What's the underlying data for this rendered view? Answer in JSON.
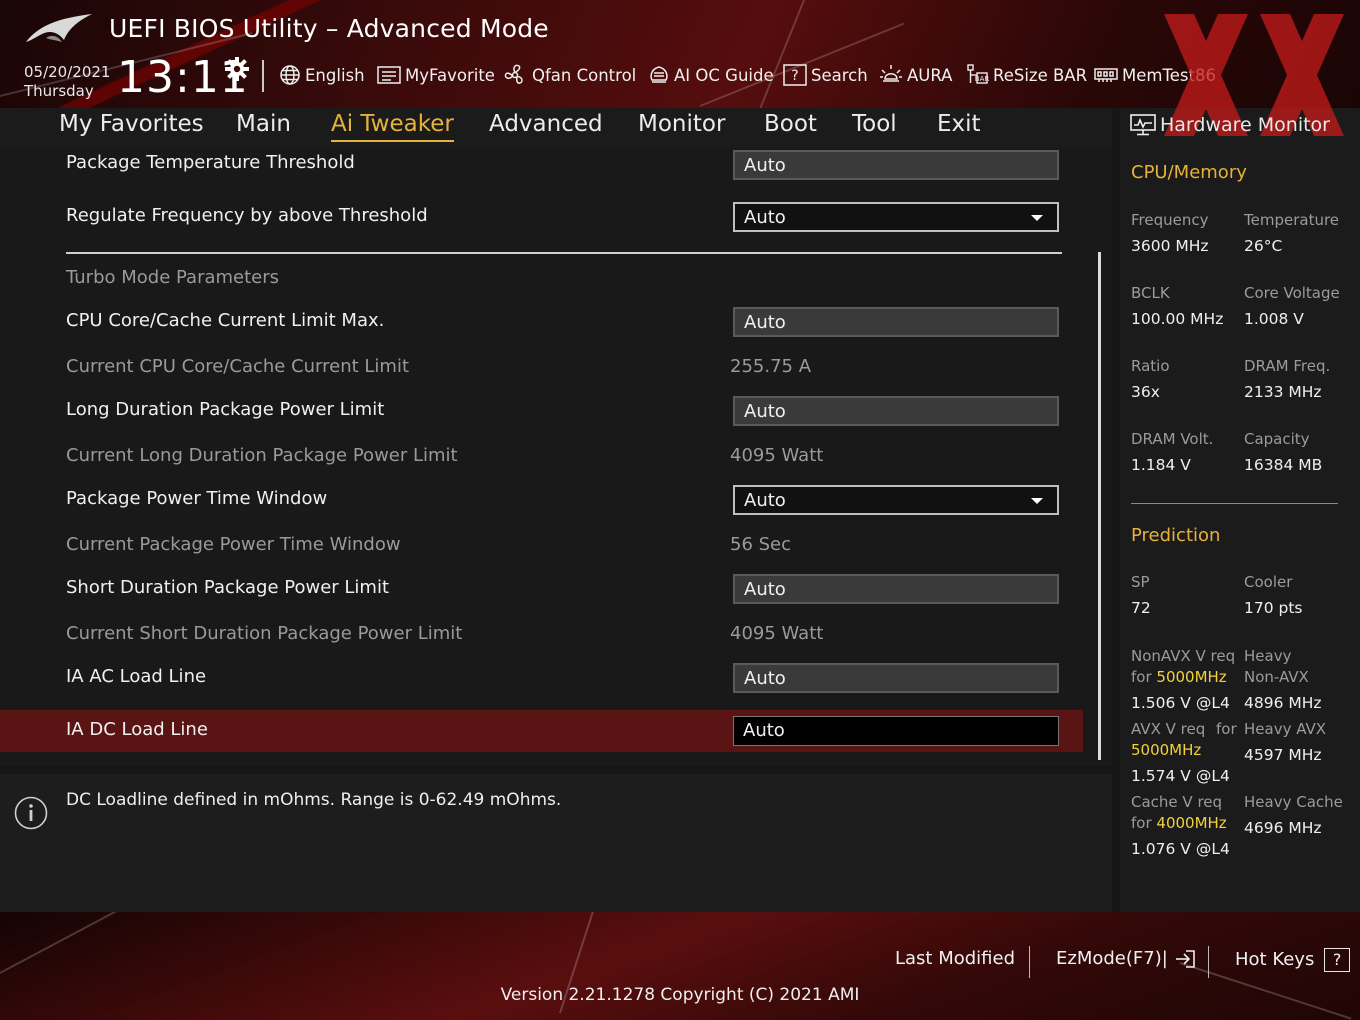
{
  "header": {
    "title": "UEFI BIOS Utility – Advanced Mode",
    "date": "05/20/2021",
    "day": "Thursday",
    "time": "13:11",
    "tools": [
      {
        "label": "English",
        "icon": "globe-icon"
      },
      {
        "label": "MyFavorite",
        "icon": "favorite-icon"
      },
      {
        "label": "Qfan Control",
        "icon": "fan-icon"
      },
      {
        "label": "AI OC Guide",
        "icon": "ai-chip-icon"
      },
      {
        "label": "Search",
        "icon": "help-box-icon"
      },
      {
        "label": "AURA",
        "icon": "aura-light-icon"
      },
      {
        "label": "ReSize BAR",
        "icon": "resize-bar-icon"
      },
      {
        "label": "MemTest86",
        "icon": "memtest-icon"
      }
    ]
  },
  "nav": {
    "tabs": [
      {
        "label": "My Favorites"
      },
      {
        "label": "Main"
      },
      {
        "label": "Ai Tweaker",
        "active": true
      },
      {
        "label": "Advanced"
      },
      {
        "label": "Monitor"
      },
      {
        "label": "Boot"
      },
      {
        "label": "Tool"
      },
      {
        "label": "Exit"
      }
    ]
  },
  "settings": {
    "package_temp_threshold": {
      "label": "Package Temperature Threshold",
      "value": "Auto"
    },
    "regulate_frequency": {
      "label": "Regulate Frequency by above Threshold",
      "value": "Auto"
    },
    "turbo_header": "Turbo Mode Parameters",
    "cpu_core_cache_limit": {
      "label": "CPU Core/Cache Current Limit Max.",
      "value": "Auto"
    },
    "current_cpu_core_cache_limit": {
      "label": "Current CPU Core/Cache Current Limit",
      "value": "255.75 A"
    },
    "long_duration_power_limit": {
      "label": "Long Duration Package Power Limit",
      "value": "Auto"
    },
    "current_long_duration_limit": {
      "label": "Current Long Duration Package Power Limit",
      "value": "4095 Watt"
    },
    "package_power_time_window": {
      "label": "Package Power Time Window",
      "value": "Auto"
    },
    "current_power_time_window": {
      "label": "Current Package Power Time Window",
      "value": "56 Sec"
    },
    "short_duration_power_limit": {
      "label": "Short Duration Package Power Limit",
      "value": "Auto"
    },
    "current_short_duration_limit": {
      "label": "Current Short Duration Package Power Limit",
      "value": "4095 Watt"
    },
    "ia_ac_load_line": {
      "label": "IA AC Load Line",
      "value": "Auto"
    },
    "ia_dc_load_line": {
      "label": "IA DC Load Line",
      "value": "Auto"
    }
  },
  "help": {
    "text": "DC Loadline defined in mOhms. Range is 0-62.49 mOhms."
  },
  "hardware_monitor": {
    "title": "Hardware Monitor",
    "cpu_memory": {
      "heading": "CPU/Memory",
      "frequency_label": "Frequency",
      "frequency": "3600 MHz",
      "temperature_label": "Temperature",
      "temperature": "26°C",
      "bclk_label": "BCLK",
      "bclk": "100.00 MHz",
      "core_voltage_label": "Core Voltage",
      "core_voltage": "1.008 V",
      "ratio_label": "Ratio",
      "ratio": "36x",
      "dram_freq_label": "DRAM Freq.",
      "dram_freq": "2133 MHz",
      "dram_volt_label": "DRAM Volt.",
      "dram_volt": "1.184 V",
      "capacity_label": "Capacity",
      "capacity": "16384 MB"
    },
    "prediction": {
      "heading": "Prediction",
      "sp_label": "SP",
      "sp": "72",
      "cooler_label": "Cooler",
      "cooler": "170 pts",
      "nonavx_label_1": "NonAVX V req",
      "nonavx_label_2_prefix": "for ",
      "nonavx_freq": "5000MHz",
      "nonavx_value": "1.506 V @L4",
      "heavy_nonavx_label_1": "Heavy",
      "heavy_nonavx_label_2": "Non-AVX",
      "heavy_nonavx_value": "4896 MHz",
      "avx_label_1": "AVX V req",
      "avx_label_for": "for",
      "avx_freq": "5000MHz",
      "avx_value": "1.574 V @L4",
      "heavy_avx_label": "Heavy AVX",
      "heavy_avx_value": "4597 MHz",
      "cache_label_1": "Cache V req",
      "cache_label_2_prefix": "for ",
      "cache_freq": "4000MHz",
      "cache_value": "1.076 V @L4",
      "heavy_cache_label": "Heavy Cache",
      "heavy_cache_value": "4696 MHz"
    }
  },
  "footer": {
    "last_modified": "Last Modified",
    "ezmode": "EzMode(F7)|",
    "hot_keys": "Hot Keys",
    "hot_keys_glyph": "?",
    "version": "Version 2.21.1278 Copyright (C) 2021 AMI"
  },
  "colors": {
    "accent": "#e6b23a",
    "highlight_value": "#f2d23a",
    "selected_row": "#5b1414",
    "header_red": "#560d0d"
  }
}
